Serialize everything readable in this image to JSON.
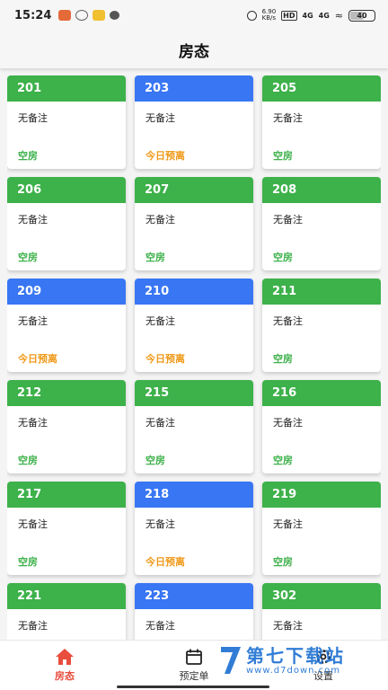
{
  "status_bar": {
    "time": "15:24",
    "speed_value": "6.90",
    "speed_unit": "KB/s",
    "hd_label": "HD",
    "signal1": "4G",
    "signal2": "4G",
    "battery": "40",
    "left_icons": [
      "signal-app-icon",
      "loop-icon",
      "game-app-icon",
      "chat-bubble-icon"
    ]
  },
  "header": {
    "title": "房态"
  },
  "rooms": [
    {
      "number": "201",
      "note": "无备注",
      "status": "空房",
      "color": "#3db14a"
    },
    {
      "number": "203",
      "note": "无备注",
      "status": "今日预离",
      "color": "#3876f3"
    },
    {
      "number": "205",
      "note": "无备注",
      "status": "空房",
      "color": "#3db14a"
    },
    {
      "number": "206",
      "note": "无备注",
      "status": "空房",
      "color": "#3db14a"
    },
    {
      "number": "207",
      "note": "无备注",
      "status": "空房",
      "color": "#3db14a"
    },
    {
      "number": "208",
      "note": "无备注",
      "status": "空房",
      "color": "#3db14a"
    },
    {
      "number": "209",
      "note": "无备注",
      "status": "今日预离",
      "color": "#3876f3"
    },
    {
      "number": "210",
      "note": "无备注",
      "status": "今日预离",
      "color": "#3876f3"
    },
    {
      "number": "211",
      "note": "无备注",
      "status": "空房",
      "color": "#3db14a"
    },
    {
      "number": "212",
      "note": "无备注",
      "status": "空房",
      "color": "#3db14a"
    },
    {
      "number": "215",
      "note": "无备注",
      "status": "空房",
      "color": "#3db14a"
    },
    {
      "number": "216",
      "note": "无备注",
      "status": "空房",
      "color": "#3db14a"
    },
    {
      "number": "217",
      "note": "无备注",
      "status": "空房",
      "color": "#3db14a"
    },
    {
      "number": "218",
      "note": "无备注",
      "status": "今日预离",
      "color": "#3876f3"
    },
    {
      "number": "219",
      "note": "无备注",
      "status": "空房",
      "color": "#3db14a"
    },
    {
      "number": "221",
      "note": "无备注",
      "status": "",
      "color": "#3db14a"
    },
    {
      "number": "223",
      "note": "无备注",
      "status": "",
      "color": "#3876f3"
    },
    {
      "number": "302",
      "note": "无备注",
      "status": "",
      "color": "#3db14a"
    }
  ],
  "nav": {
    "items": [
      {
        "label": "房态",
        "icon": "home-icon",
        "active": true
      },
      {
        "label": "预定单",
        "icon": "calendar-icon",
        "active": false
      },
      {
        "label": "设置",
        "icon": "gear-icon",
        "active": false
      }
    ]
  },
  "watermark": {
    "title": "第七下载站",
    "url": "www.d7down.com"
  },
  "colors": {
    "vacant": "#3db14a",
    "checkout_today": "#ef9a1a",
    "occupied_header": "#3876f3",
    "active_nav": "#e84d3d"
  }
}
